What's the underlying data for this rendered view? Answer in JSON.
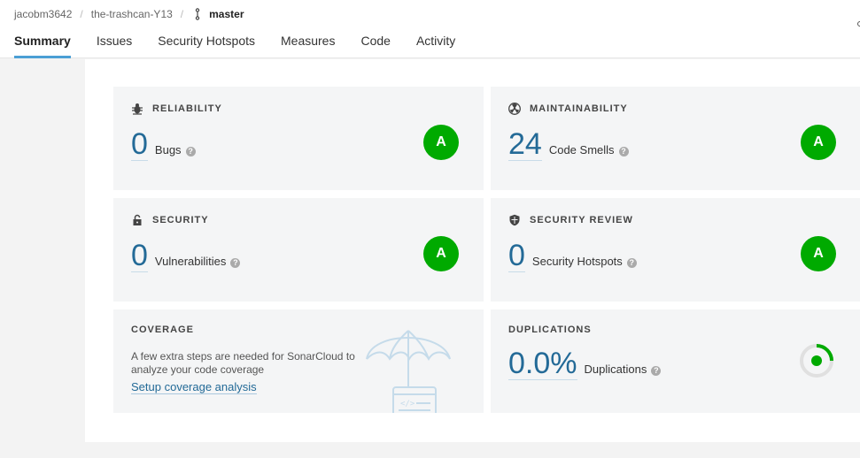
{
  "breadcrumb": {
    "org": "jacobm3642",
    "project": "the-trashcan-Y13",
    "branch": "master"
  },
  "tabs": [
    {
      "label": "Summary",
      "active": true
    },
    {
      "label": "Issues"
    },
    {
      "label": "Security Hotspots"
    },
    {
      "label": "Measures"
    },
    {
      "label": "Code"
    },
    {
      "label": "Activity"
    }
  ],
  "reliability": {
    "title": "RELIABILITY",
    "value": "0",
    "label": "Bugs",
    "grade": "A",
    "icon": "bug-icon"
  },
  "maintainability": {
    "title": "MAINTAINABILITY",
    "value": "24",
    "label": "Code Smells",
    "grade": "A",
    "icon": "radiation-icon"
  },
  "security": {
    "title": "SECURITY",
    "value": "0",
    "label": "Vulnerabilities",
    "grade": "A",
    "icon": "lock-icon"
  },
  "security_review": {
    "title": "SECURITY REVIEW",
    "value": "0",
    "label": "Security Hotspots",
    "grade": "A",
    "icon": "shield-icon"
  },
  "coverage": {
    "title": "COVERAGE",
    "text": "A few extra steps are needed for SonarCloud to analyze your code coverage",
    "link": "Setup coverage analysis",
    "icon": "umbrella-illustration"
  },
  "duplications": {
    "title": "DUPLICATIONS",
    "value": "0.0%",
    "label": "Duplications",
    "fraction": 0.0
  },
  "help_glyph": "?",
  "colors": {
    "grade_a": "#00aa00",
    "link": "#236a97",
    "tab_underline": "#4b9fd5"
  }
}
